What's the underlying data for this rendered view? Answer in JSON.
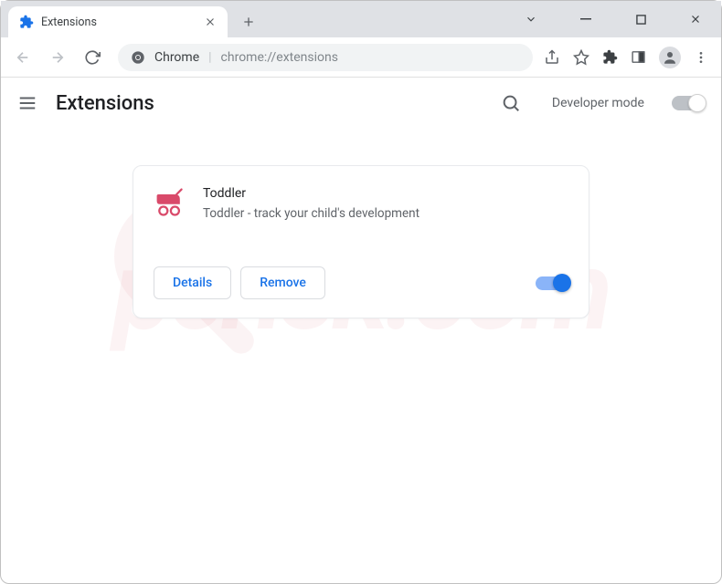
{
  "tab": {
    "title": "Extensions"
  },
  "omnibox": {
    "scheme": "Chrome",
    "url": "chrome://extensions"
  },
  "page": {
    "title": "Extensions",
    "developer_mode_label": "Developer mode"
  },
  "extension": {
    "name": "Toddler",
    "description": "Toddler - track your child's development",
    "details_label": "Details",
    "remove_label": "Remove",
    "enabled": true
  }
}
